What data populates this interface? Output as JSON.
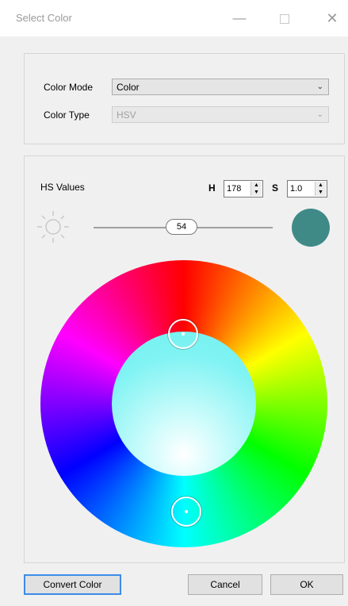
{
  "window": {
    "title": "Select Color",
    "minimize": "—",
    "close": "✕"
  },
  "color_settings": {
    "mode_label": "Color Mode",
    "mode_value": "Color",
    "type_label": "Color Type",
    "type_value": "HSV"
  },
  "hs_panel": {
    "label": "HS Values",
    "h_label": "H",
    "h_value": "178",
    "s_label": "S",
    "s_value": "1.0",
    "brightness_value": "54",
    "preview_color": "#3f8a87",
    "wheel_inner_color": "#70f0f0"
  },
  "icons": {
    "brightness": "sun-icon",
    "dropdown": "chevron-down-icon",
    "spin": "spin-arrows-icon"
  },
  "buttons": {
    "convert": "Convert Color",
    "cancel": "Cancel",
    "ok": "OK"
  }
}
